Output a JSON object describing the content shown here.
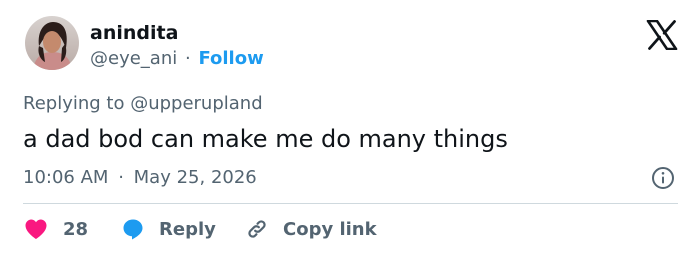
{
  "author": {
    "display_name": "anindita",
    "handle": "@eye_ani",
    "separator": "·",
    "follow_label": "Follow",
    "avatar_icon": "profile-photo"
  },
  "platform_icon": "x-logo-icon",
  "tweet": {
    "replying_to": "Replying to @upperupland",
    "text": "a dad bod can make me do many things",
    "time": "10:06 AM",
    "date_separator": "·",
    "date": "May 25, 2026"
  },
  "actions": {
    "like_count": "28",
    "reply_label": "Reply",
    "copy_link_label": "Copy link"
  },
  "colors": {
    "accent": "#1d9bf0",
    "like": "#f91880",
    "text_primary": "#0f1419",
    "text_secondary": "#536471",
    "divider": "#cfd9de"
  }
}
